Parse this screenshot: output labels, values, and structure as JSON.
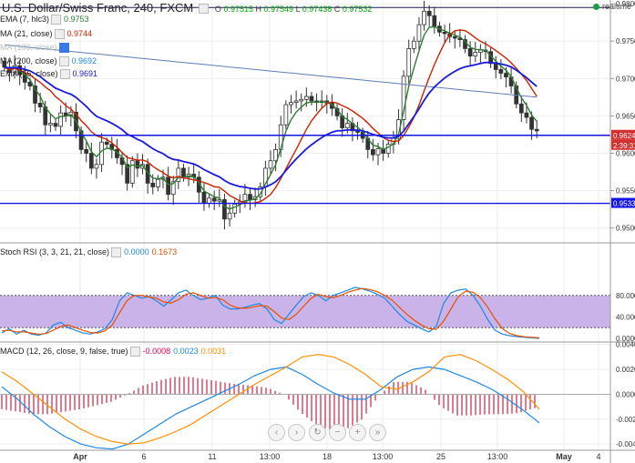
{
  "header": {
    "title": "U.S. Dollar/Swiss Franc, 240, FXCM",
    "ohlc": {
      "o_label": "O",
      "o": "0.97515",
      "h_label": "H",
      "h": "0.97549",
      "l_label": "L",
      "l": "0.97438",
      "c_label": "C",
      "c": "0.97532"
    },
    "realtime": "realtime"
  },
  "indicators": {
    "ema7": {
      "label": "EMA (7, hlc3)",
      "value": "0.9753",
      "color": "#2e7d32"
    },
    "ma21": {
      "label": "MA (21, close)",
      "value": "0.9744",
      "color": "#cc2200"
    },
    "ma100": {
      "label": "MA (100, close)",
      "value": "",
      "color": "#5b7fb5"
    },
    "ma200": {
      "label": "MA (200, close)",
      "value": "0.9692",
      "color": "#1e88e5"
    },
    "ema55": {
      "label": "EMA (55, close)",
      "value": "0.9691",
      "color": "#1a1adb"
    }
  },
  "stoch": {
    "label": "Stoch RSI (3, 3, 21, 21, close)",
    "k": "0.0000",
    "d": "0.1673"
  },
  "macd": {
    "label": "MACD (12, 26, close, 9, false, true)",
    "hist": "-0.0008",
    "macd": "0.0023",
    "signal": "0.0031"
  },
  "nav_icons": [
    "chevron-left-icon",
    "chevron-right-icon",
    "reset-icon",
    "zoom-out-icon",
    "zoom-in-icon",
    "chevron-right-end-icon"
  ],
  "chart_data": [
    {
      "type": "candlestick",
      "title": "U.S. Dollar/Swiss Franc, 240, FXCM",
      "ylim": [
        0.9485,
        0.9805
      ],
      "yticks": [
        "0.9800",
        "0.9750",
        "0.9700",
        "0.9650",
        "0.9600",
        "0.9550",
        "0.9500"
      ],
      "price_labels": [
        "0.9624",
        "2:39:31",
        "0.9533"
      ],
      "hlines": [
        0.9624,
        0.9533,
        0.9795
      ],
      "xticks": [
        "Apr",
        "6",
        "11",
        "13:00",
        "18",
        "13:00",
        "25",
        "13:00",
        "May",
        "4"
      ],
      "closes": [
        0.9715,
        0.9708,
        0.9717,
        0.9705,
        0.9695,
        0.969,
        0.9667,
        0.9662,
        0.9638,
        0.964,
        0.9636,
        0.9654,
        0.965,
        0.9655,
        0.963,
        0.9605,
        0.96,
        0.958,
        0.9585,
        0.9615,
        0.9612,
        0.9605,
        0.9594,
        0.9585,
        0.956,
        0.959,
        0.958,
        0.9585,
        0.956,
        0.9555,
        0.9565,
        0.9568,
        0.9545,
        0.9562,
        0.958,
        0.9568,
        0.9572,
        0.9568,
        0.9548,
        0.9533,
        0.954,
        0.9536,
        0.9538,
        0.9512,
        0.952,
        0.9532,
        0.9535,
        0.9545,
        0.9538,
        0.9542,
        0.9555,
        0.958,
        0.959,
        0.9605,
        0.9638,
        0.9665,
        0.9668,
        0.967,
        0.9672,
        0.9676,
        0.967,
        0.9668,
        0.967,
        0.9667,
        0.966,
        0.965,
        0.9634,
        0.964,
        0.963,
        0.9628,
        0.962,
        0.9605,
        0.9598,
        0.9606,
        0.96,
        0.9612,
        0.962,
        0.9645,
        0.9703,
        0.974,
        0.975,
        0.9772,
        0.979,
        0.9784,
        0.977,
        0.9762,
        0.976,
        0.9756,
        0.9754,
        0.9752,
        0.974,
        0.973,
        0.9735,
        0.9738,
        0.9736,
        0.972,
        0.9712,
        0.9707,
        0.9702,
        0.969,
        0.9666,
        0.9654,
        0.9648,
        0.9632,
        0.963
      ],
      "series": [
        {
          "name": "EMA (7, hlc3)",
          "color": "#2e7d32"
        },
        {
          "name": "MA (21, close)",
          "color": "#cc2200"
        },
        {
          "name": "MA (200, close)",
          "color": "#1e88e5"
        },
        {
          "name": "EMA (55, close)",
          "color": "#1a1adb"
        }
      ]
    },
    {
      "type": "line",
      "title": "Stoch RSI (3, 3, 21, 21, close)",
      "ylim": [
        0,
        100
      ],
      "yticks": [
        "80.0000",
        "40.0000",
        "0.0000"
      ],
      "band": [
        20,
        80
      ],
      "series": [
        {
          "name": "K",
          "color": "#1e88e5",
          "values": [
            10,
            18,
            8,
            15,
            8,
            6,
            10,
            25,
            30,
            20,
            15,
            10,
            8,
            12,
            18,
            35,
            70,
            85,
            80,
            75,
            78,
            70,
            60,
            72,
            85,
            90,
            80,
            72,
            75,
            80,
            62,
            55,
            55,
            58,
            62,
            65,
            55,
            35,
            28,
            45,
            62,
            78,
            85,
            80,
            70,
            80,
            85,
            90,
            95,
            92,
            88,
            82,
            75,
            60,
            45,
            32,
            25,
            18,
            12,
            22,
            65,
            85,
            90,
            92,
            80,
            60,
            35,
            15,
            8,
            5,
            3,
            2,
            1,
            0
          ]
        },
        {
          "name": "D",
          "color": "#e65100",
          "values": [
            14,
            15,
            12,
            12,
            10,
            8,
            9,
            15,
            22,
            25,
            20,
            15,
            11,
            10,
            14,
            25,
            48,
            70,
            80,
            80,
            77,
            75,
            68,
            66,
            72,
            82,
            85,
            80,
            75,
            76,
            72,
            62,
            57,
            56,
            58,
            61,
            60,
            50,
            38,
            35,
            45,
            60,
            75,
            82,
            78,
            76,
            80,
            86,
            90,
            93,
            91,
            87,
            80,
            71,
            58,
            45,
            34,
            25,
            18,
            17,
            32,
            55,
            78,
            88,
            86,
            76,
            58,
            36,
            18,
            9,
            5,
            3,
            2,
            1
          ]
        }
      ]
    },
    {
      "type": "bar",
      "title": "MACD (12, 26, close, 9, false, true)",
      "ylim": [
        -0.0045,
        0.0042
      ],
      "yticks": [
        "0.0040",
        "0.0020",
        "0.0000",
        "-0.0020",
        "-0.0040"
      ],
      "series": [
        {
          "name": "MACD",
          "color": "#1e88e5",
          "values": [
            0.0006,
            -0.0004,
            -0.0016,
            -0.0026,
            -0.0034,
            -0.004,
            -0.0043,
            -0.0044,
            -0.004,
            -0.0032,
            -0.0024,
            -0.0016,
            -0.001,
            -0.0004,
            0.0002,
            0.0008,
            0.0015,
            0.002,
            0.0022,
            0.0016,
            0.0008,
            0.0001,
            -0.0004,
            -0.0004,
            0.0004,
            0.0014,
            0.002,
            0.0022,
            0.002,
            0.0015,
            0.001,
            0.0004,
            -0.0004,
            -0.0013,
            -0.0023
          ]
        },
        {
          "name": "Signal",
          "color": "#ff8f00",
          "values": [
            0.0018,
            0.001,
            0.0,
            -0.001,
            -0.002,
            -0.0028,
            -0.0034,
            -0.0038,
            -0.004,
            -0.0039,
            -0.0035,
            -0.003,
            -0.0024,
            -0.0016,
            -0.0008,
            0.0,
            0.0008,
            0.0015,
            0.0022,
            0.003,
            0.0032,
            0.003,
            0.0024,
            0.0016,
            0.0006,
            0.0004,
            0.001,
            0.0018,
            0.003,
            0.0032,
            0.0027,
            0.002,
            0.0012,
            0.0002,
            -0.0012
          ]
        }
      ]
    }
  ]
}
